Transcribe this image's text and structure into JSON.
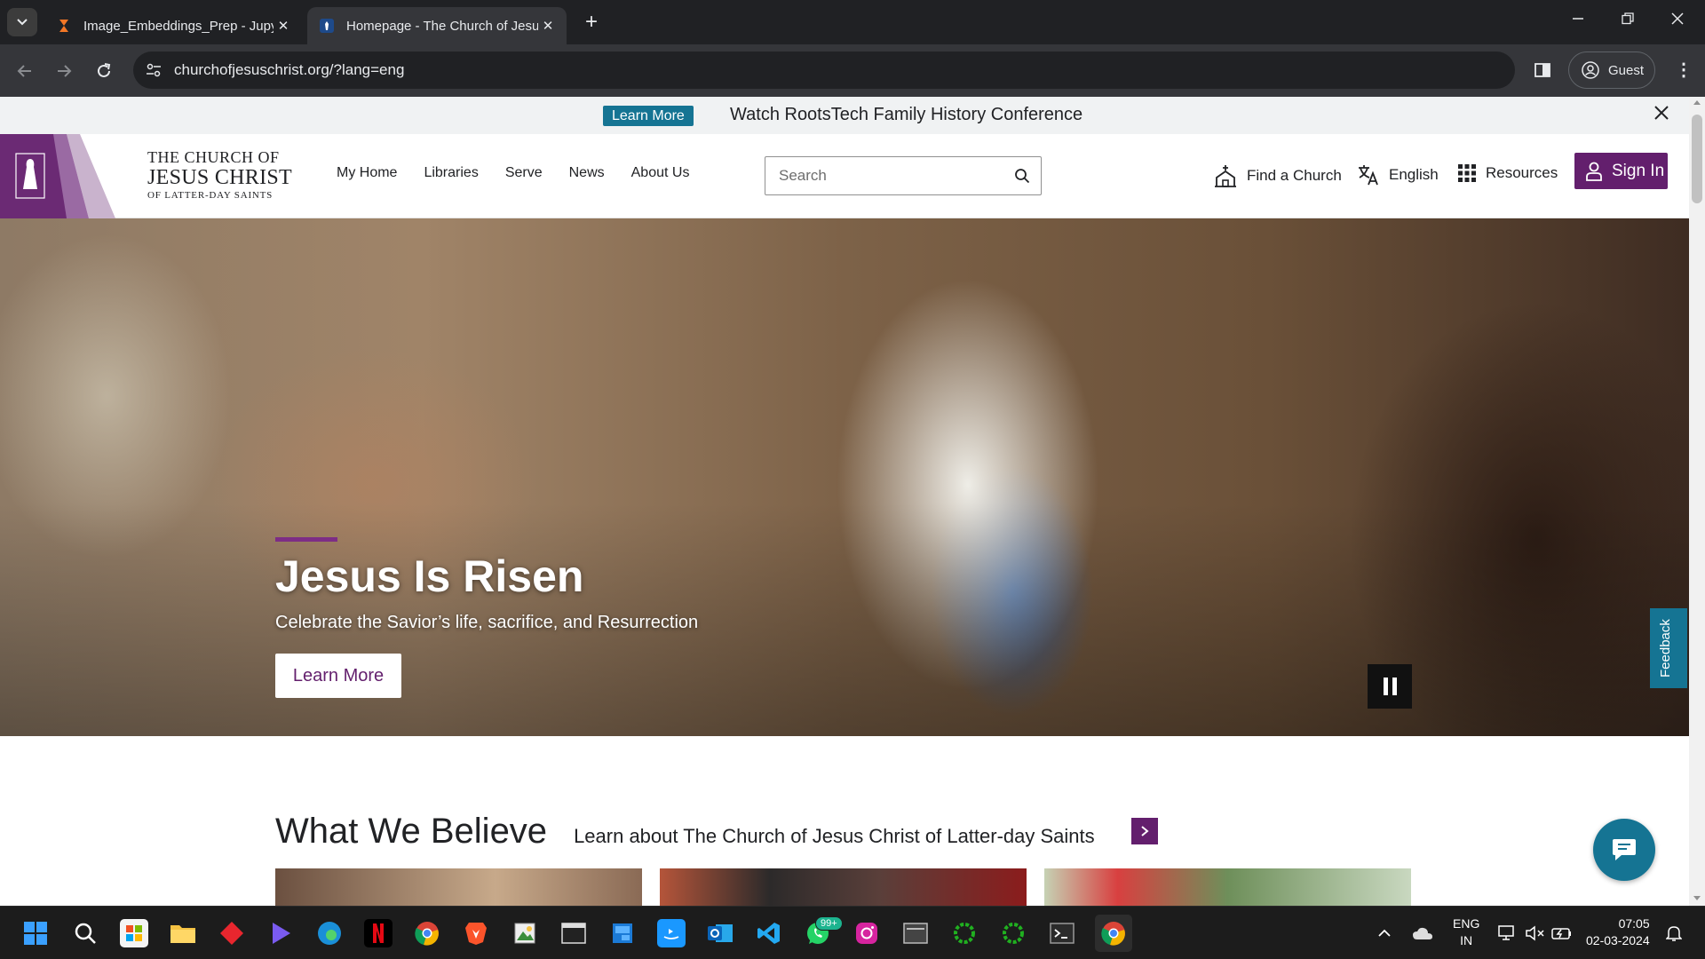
{
  "browser": {
    "tabs": [
      {
        "title": "Image_Embeddings_Prep - Jupyter",
        "active": false
      },
      {
        "title": "Homepage - The Church of Jesus Christ",
        "active": true
      }
    ],
    "url": "churchofjesuschrist.org/?lang=eng",
    "profile_label": "Guest"
  },
  "banner": {
    "button_label": "Learn More",
    "message": "Watch RootsTech Family History Conference"
  },
  "header": {
    "logo": {
      "line1": "THE CHURCH OF",
      "line2": "JESUS CHRIST",
      "line3": "OF LATTER-DAY SAINTS"
    },
    "nav": [
      "My Home",
      "Libraries",
      "Serve",
      "News",
      "About Us"
    ],
    "search_placeholder": "Search",
    "find_church": "Find a Church",
    "language": "English",
    "resources": "Resources",
    "sign_in": "Sign In"
  },
  "hero": {
    "title": "Jesus Is Risen",
    "subtitle": "Celebrate the Savior’s life, sacrifice, and Resurrection",
    "button": "Learn More"
  },
  "feedback_label": "Feedback",
  "believe": {
    "heading": "What We Believe",
    "subheading": "Learn about The Church of Jesus Christ of Latter-day Saints"
  },
  "taskbar": {
    "notification_badge": "99+",
    "language_line1": "ENG",
    "language_line2": "IN",
    "time": "07:05",
    "date": "02-03-2024"
  },
  "colors": {
    "brand_purple": "#631f6d",
    "teal": "#157493",
    "chrome_dark": "#202124"
  }
}
